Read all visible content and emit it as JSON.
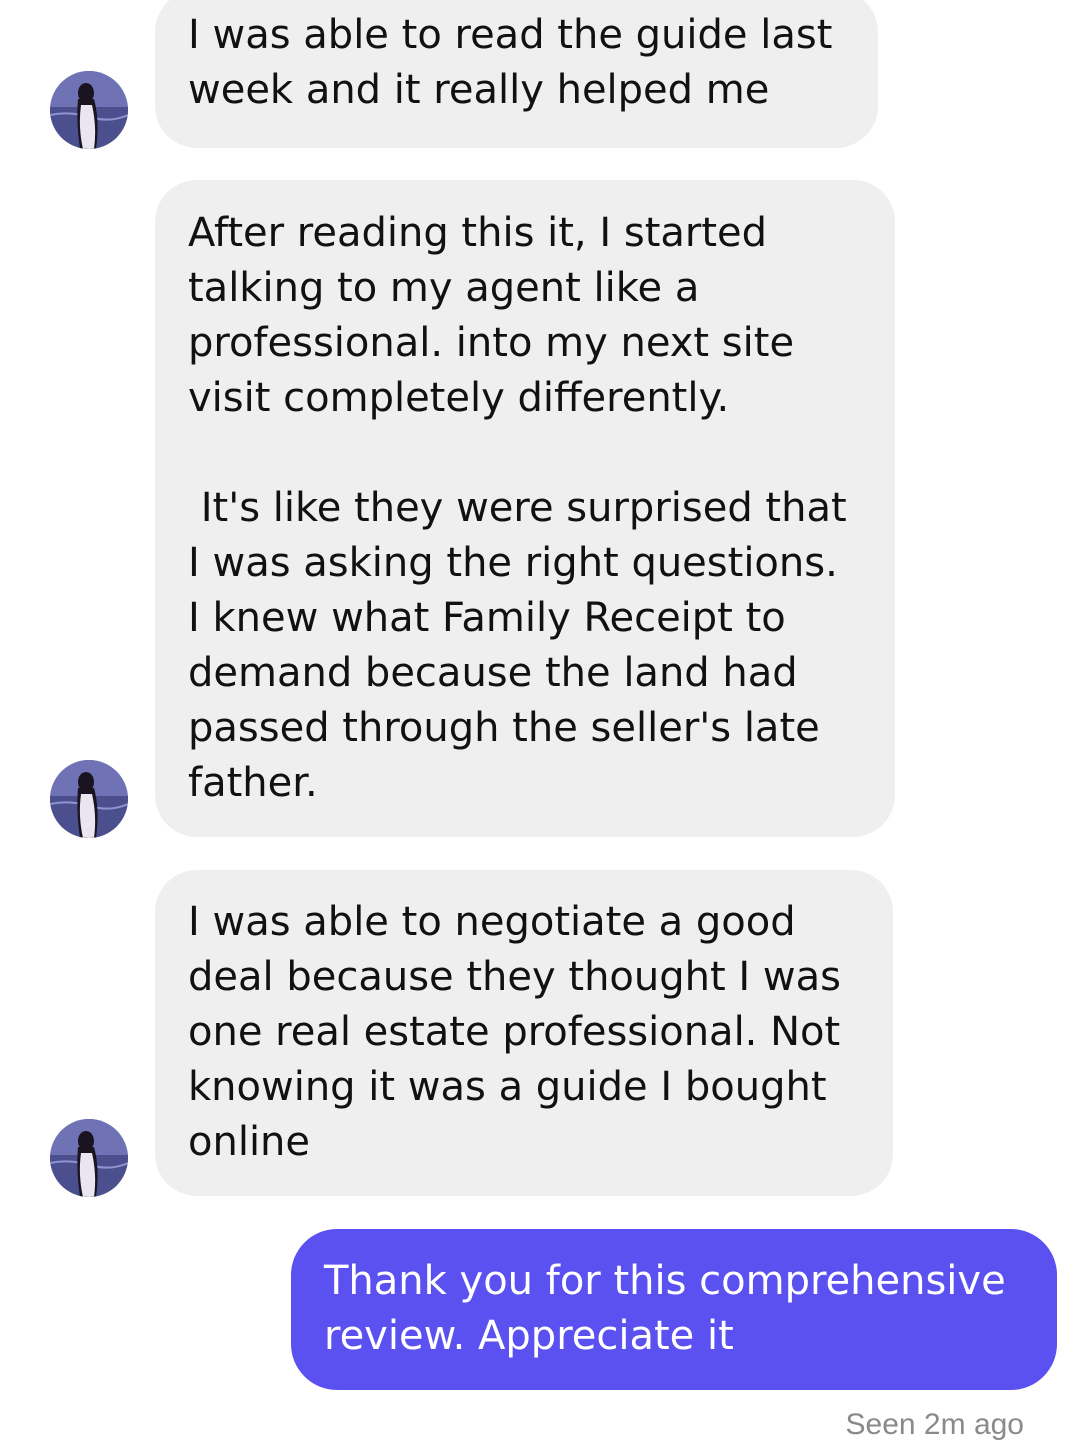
{
  "thread": {
    "messages": [
      {
        "sender": "contact",
        "text": "I was able to read the guide last\nweek and it really helped me"
      },
      {
        "sender": "contact",
        "text": "After reading this it, I started\ntalking to my agent like a\nprofessional. into my next site\nvisit completely differently.\n\n It's like they were surprised that\nI was asking the right questions.\nI knew what Family Receipt to\ndemand because the land had\npassed through the seller's late\nfather."
      },
      {
        "sender": "contact",
        "text": "I was able to negotiate a good\ndeal because they thought I was\none real estate professional. Not\nknowing it was a guide I bought\nonline"
      },
      {
        "sender": "me",
        "text": "Thank you for this comprehensive\nreview. Appreciate it"
      }
    ],
    "seen_status": "Seen 2m ago"
  },
  "avatar": {
    "icon": "profile-photo",
    "colors": {
      "sky": "#6f73b5",
      "sea": "#4b4f8e",
      "figure": "#1a1420",
      "dress": "#e9e6ef"
    }
  },
  "colors": {
    "incoming_bubble": "#efefef",
    "outgoing_bubble": "#5b51f1",
    "seen_text": "#8a8a8a"
  }
}
